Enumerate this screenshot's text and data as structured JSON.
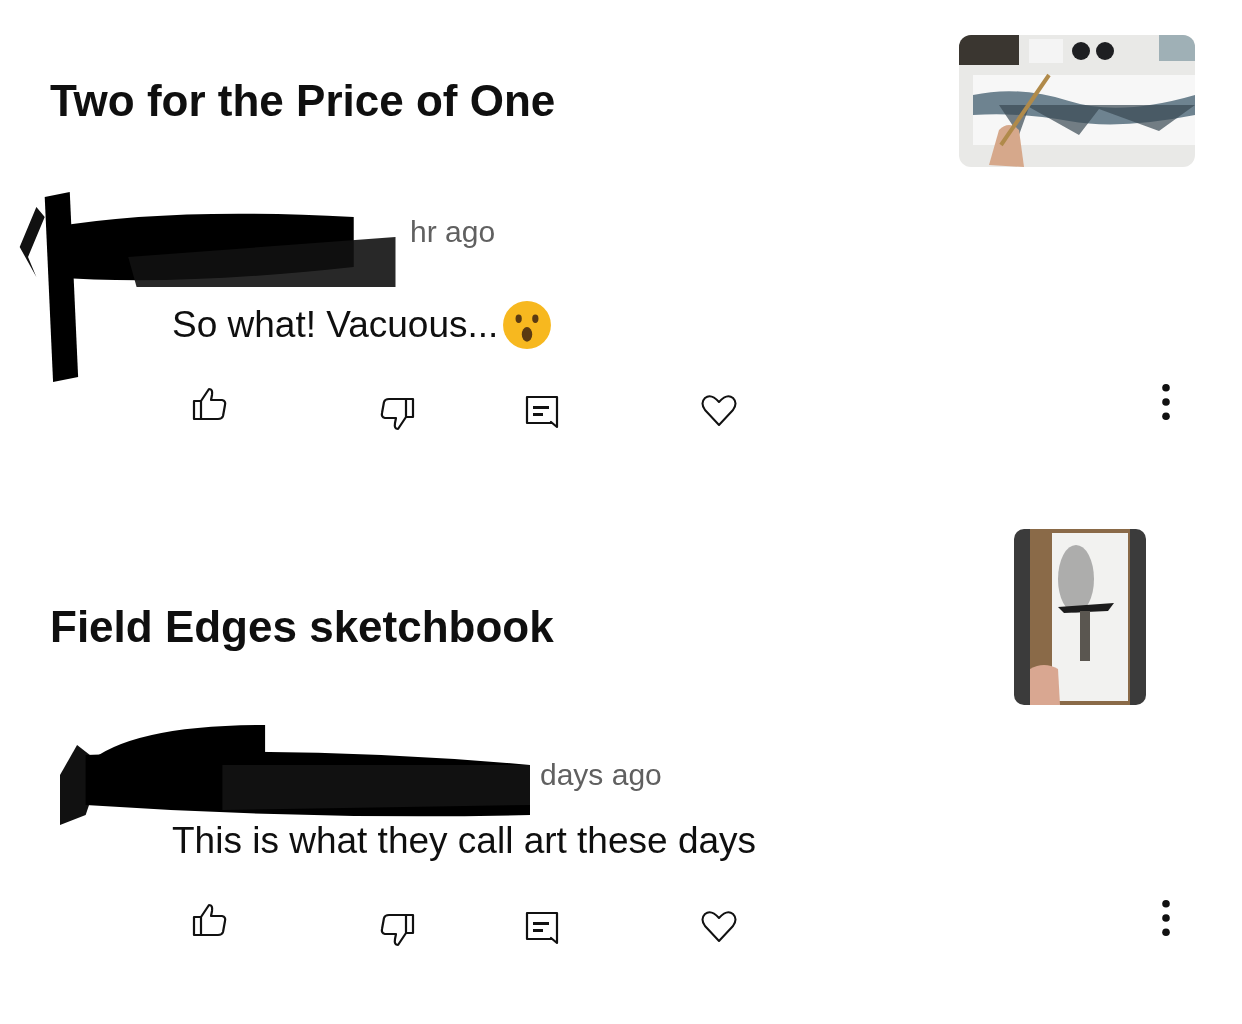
{
  "comments": [
    {
      "kind": "with-emoji",
      "video_title": "Two for the Price of One",
      "meta": "hr ago",
      "text": "So what! Vacuous..."
    },
    {
      "kind": "plain",
      "video_title": "Field Edges sketchbook",
      "meta": "days ago",
      "text": "This is what they call art these days"
    }
  ]
}
